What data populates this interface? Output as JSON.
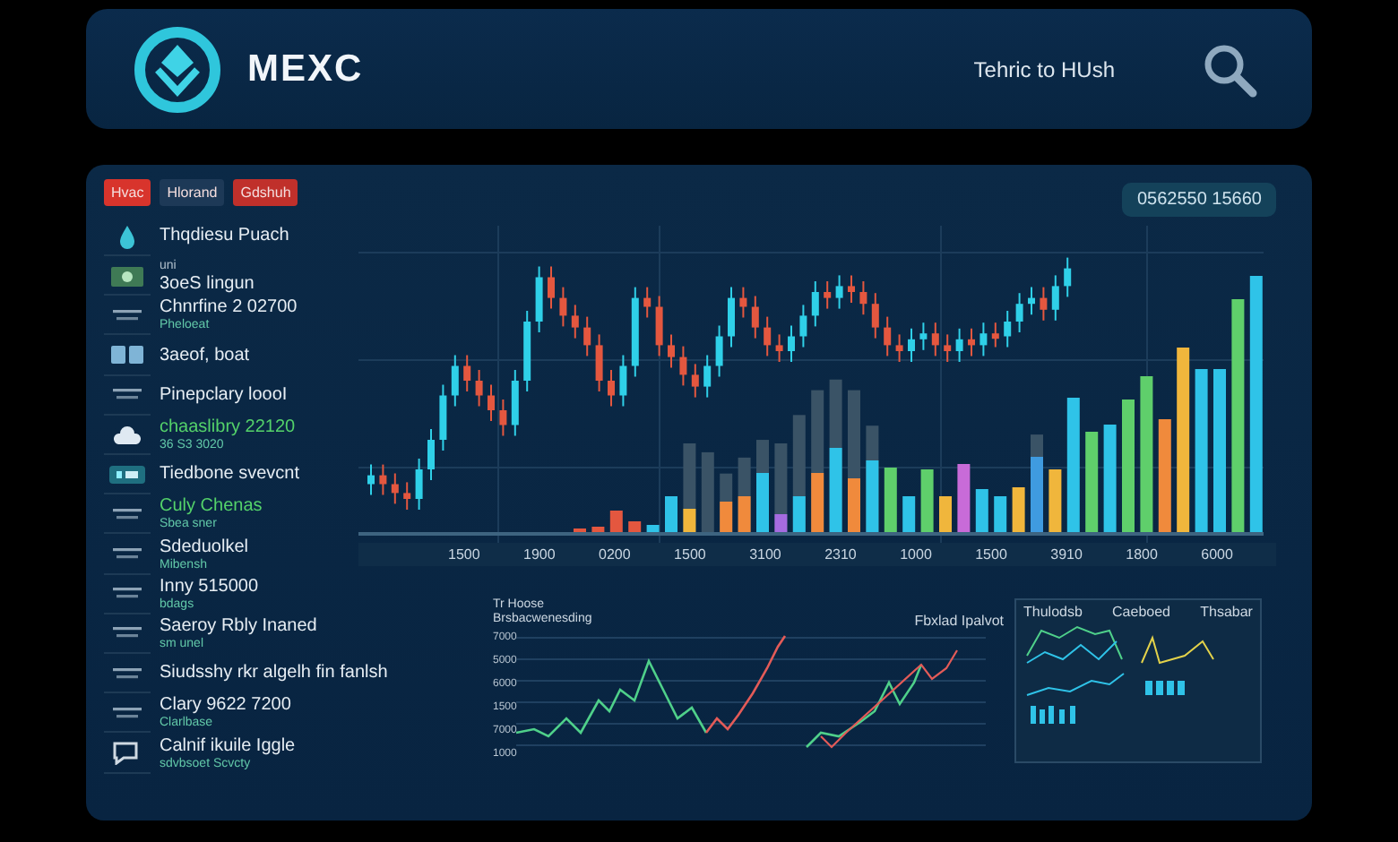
{
  "header": {
    "brand": "MEXC",
    "tagline": "Tehric to HUsh"
  },
  "sidebar": {
    "tags": [
      {
        "label": "Hvac",
        "color": "#d8342c"
      },
      {
        "label": "Hlorand",
        "color": "#1d3957"
      },
      {
        "label": "Gdshuh",
        "color": "#c0302b"
      }
    ],
    "items": [
      {
        "title": "Thqdiesu Puach",
        "kind": "drop",
        "accent": false
      },
      {
        "overline": "uni",
        "title": "3oeS lingun",
        "kind": "cash",
        "accent": false
      },
      {
        "title": "Chnrfine 2 02700",
        "subtitle": "Pheloeat",
        "kind": "lines",
        "accent": false
      },
      {
        "title": "3aeof, boat",
        "kind": "cards",
        "accent": false
      },
      {
        "title": "Pinepclary loooI",
        "kind": "lines",
        "accent": false
      },
      {
        "title": "chaaslibry 22120",
        "subtitle": "36 S3 3020",
        "kind": "cloud",
        "accent": true
      },
      {
        "title": "Tiedbone svevcnt",
        "kind": "toggle",
        "accent": false
      },
      {
        "title": "Culy Chenas",
        "subtitle": "Sbea sner",
        "kind": "lines",
        "accent": true
      },
      {
        "title": "Sdeduolkel",
        "subtitle": "Mibensh",
        "kind": "lines",
        "accent": false
      },
      {
        "title": "Inny 515000",
        "subtitle": "bdags",
        "kind": "lines",
        "accent": false
      },
      {
        "title": "Saeroy Rbly Inaned",
        "subtitle": "sm unel",
        "kind": "lines",
        "accent": false
      },
      {
        "title": "Siudsshy rkr algelh fin fanlsh",
        "kind": "lines",
        "accent": false
      },
      {
        "title": "Clary 9622 7200",
        "subtitle": "Clarlbase",
        "kind": "lines",
        "accent": false
      },
      {
        "title": "Calnif ikuile Iggle",
        "subtitle": "sdvbsoet Scvcty",
        "kind": "chat",
        "accent": false
      }
    ]
  },
  "market": {
    "price_badge": "0562550 15660",
    "axis_labels": [
      "1500",
      "1900",
      "0200",
      "1500",
      "3100",
      "2310",
      "1000",
      "1500",
      "3910",
      "1800",
      "6000"
    ]
  },
  "lower": {
    "title": "Tr Hoose",
    "subtitle": "Brsbacwenesding",
    "y_labels": [
      "7000",
      "5000",
      "6000",
      "1500",
      "7000",
      "1000"
    ],
    "chart_caption": "Fbxlad Ipalvot",
    "panel_headings": [
      "Thulodsb",
      "Caeboed",
      "Thsabar"
    ]
  }
}
